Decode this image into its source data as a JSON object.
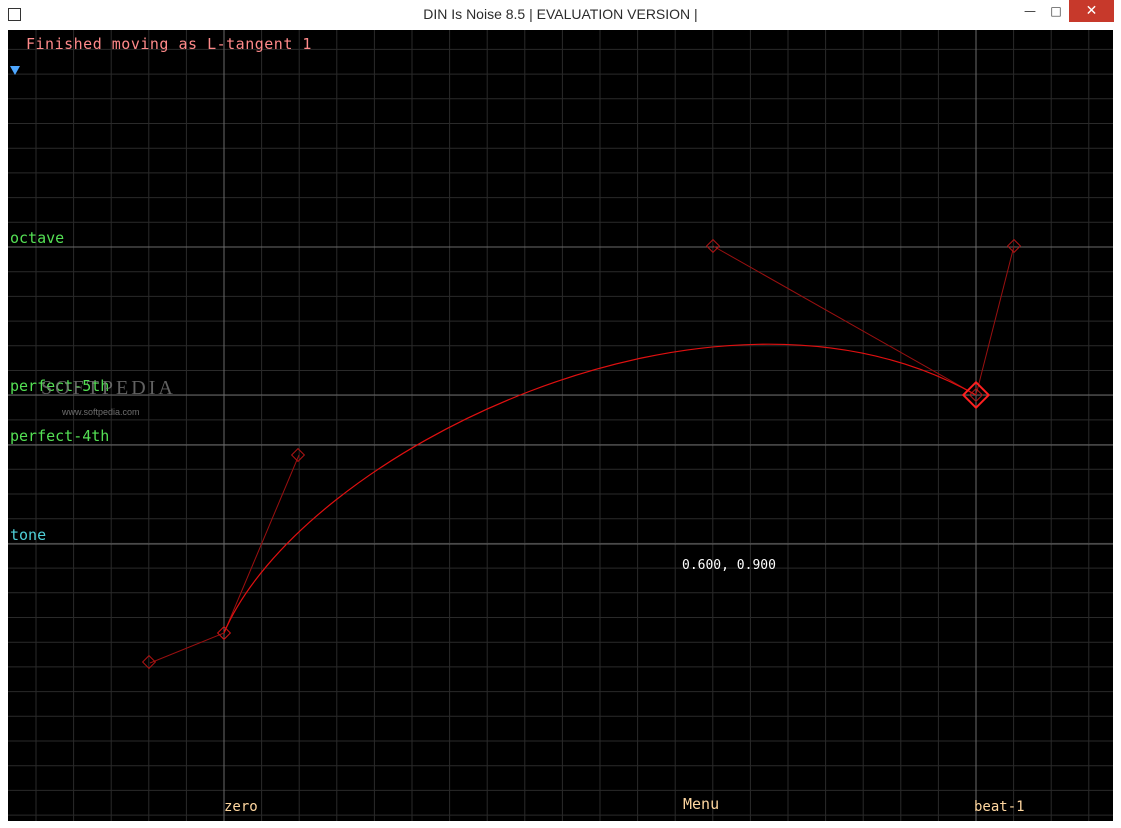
{
  "window": {
    "title": "DIN Is Noise 8.5 | EVALUATION VERSION |",
    "minimize_glyph": "—",
    "maximize_glyph": "□",
    "close_glyph": "✕"
  },
  "canvas": {
    "status_message": "Finished moving as L-tangent 1",
    "coordinate_readout": "0.600, 0.900",
    "menu_label": "Menu",
    "x_axis_labels": [
      "zero",
      "beat-1"
    ],
    "note_labels": [
      {
        "name": "octave",
        "color": "#54e054"
      },
      {
        "name": "perfect-5th",
        "color": "#54e054"
      },
      {
        "name": "perfect-4th",
        "color": "#54e054"
      },
      {
        "name": "tone",
        "color": "#4fd0d8"
      }
    ],
    "colors": {
      "background": "#000000",
      "grid": "#2a2a2a",
      "guide": "#6a6a6a",
      "curve": "#e01010",
      "handle": "#9a1010"
    }
  },
  "watermark": {
    "text": "SOFTPEDIA",
    "url": "www.softpedia.com"
  }
}
